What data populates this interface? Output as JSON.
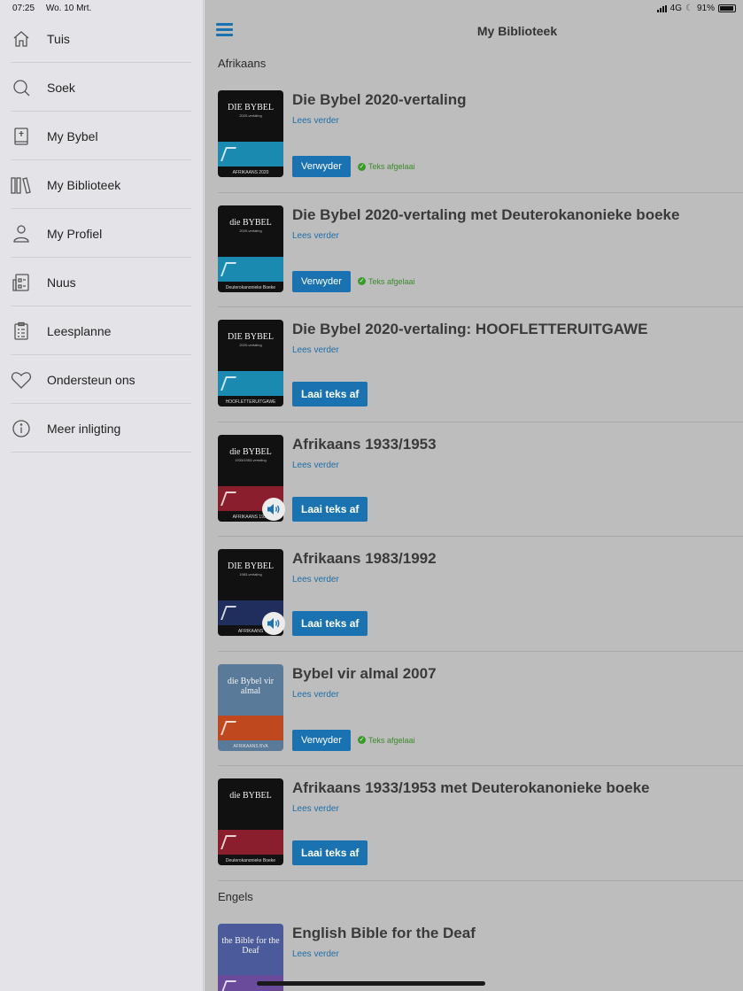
{
  "status": {
    "time": "07:25",
    "date": "Wo. 10 Mrt.",
    "network": "4G",
    "battery": "91%"
  },
  "sidebar": {
    "items": [
      {
        "label": "Tuis",
        "icon": "home-icon"
      },
      {
        "label": "Soek",
        "icon": "search-icon"
      },
      {
        "label": "My Bybel",
        "icon": "bible-icon"
      },
      {
        "label": "My Biblioteek",
        "icon": "library-icon"
      },
      {
        "label": "My Profiel",
        "icon": "profile-icon"
      },
      {
        "label": "Nuus",
        "icon": "news-icon"
      },
      {
        "label": "Leesplanne",
        "icon": "clipboard-icon"
      },
      {
        "label": "Ondersteun ons",
        "icon": "heart-icon"
      },
      {
        "label": "Meer inligting",
        "icon": "info-icon"
      }
    ]
  },
  "header": {
    "title": "My Biblioteek"
  },
  "sections": [
    {
      "label": "Afrikaans",
      "books": [
        {
          "title": "Die Bybel 2020-vertaling",
          "read_more": "Lees verder",
          "action": "Verwyder",
          "downloaded": "Teks afgelaai",
          "audio": false,
          "cover": {
            "title": "DIE BYBEL",
            "sub": "2020-vertaling",
            "band": "#1a8ab0",
            "foot": "AFRIKAANS 2020",
            "bg": "#111111"
          }
        },
        {
          "title": "Die Bybel 2020-vertaling met Deuterokanonieke boeke",
          "read_more": "Lees verder",
          "action": "Verwyder",
          "downloaded": "Teks afgelaai",
          "audio": false,
          "cover": {
            "title": "die BYBEL",
            "sub": "2020-vertaling",
            "band": "#1a8ab0",
            "foot": "Deuterokanonieke Boeke",
            "bg": "#111111"
          }
        },
        {
          "title": "Die Bybel 2020-vertaling: HOOFLETTERUITGAWE",
          "read_more": "Lees verder",
          "action": "Laai teks af",
          "downloaded": "",
          "audio": false,
          "cover": {
            "title": "DIE BYBEL",
            "sub": "2020-vertaling",
            "band": "#1a8ab0",
            "foot": "HOOFLETTERUITGAWE",
            "bg": "#111111"
          }
        },
        {
          "title": "Afrikaans 1933/1953",
          "read_more": "Lees verder",
          "action": "Laai teks af",
          "downloaded": "",
          "audio": true,
          "cover": {
            "title": "die BYBEL",
            "sub": "1933/1953-vertaling",
            "band": "#8a1e2c",
            "foot": "AFRIKAANS 1933",
            "bg": "#111111"
          }
        },
        {
          "title": "Afrikaans 1983/1992",
          "read_more": "Lees verder",
          "action": "Laai teks af",
          "downloaded": "",
          "audio": true,
          "cover": {
            "title": "DIE BYBEL",
            "sub": "1983-vertaling",
            "band": "#1f2e5c",
            "foot": "AFRIKAANS",
            "bg": "#111111"
          }
        },
        {
          "title": "Bybel vir almal 2007",
          "read_more": "Lees verder",
          "action": "Verwyder",
          "downloaded": "Teks afgelaai",
          "audio": false,
          "cover": {
            "title": "die Bybel vir almal",
            "sub": "",
            "band": "#c0481e",
            "foot": "AFRIKAANS BVA",
            "bg": "#5a7a9a"
          }
        },
        {
          "title": "Afrikaans 1933/1953 met Deuterokanonieke boeke",
          "read_more": "Lees verder",
          "action": "Laai teks af",
          "downloaded": "",
          "audio": false,
          "cover": {
            "title": "die BYBEL",
            "sub": "",
            "band": "#8a1e2c",
            "foot": "Deuterokanonieke Boeke",
            "bg": "#111111"
          }
        }
      ]
    },
    {
      "label": "Engels",
      "books": [
        {
          "title": "English Bible for the Deaf",
          "read_more": "Lees verder",
          "action": "",
          "downloaded": "",
          "audio": false,
          "cover": {
            "title": "the Bible for the Deaf",
            "sub": "",
            "band": "#6a4a9a",
            "foot": "",
            "bg": "#4a5a9a"
          }
        }
      ]
    }
  ]
}
